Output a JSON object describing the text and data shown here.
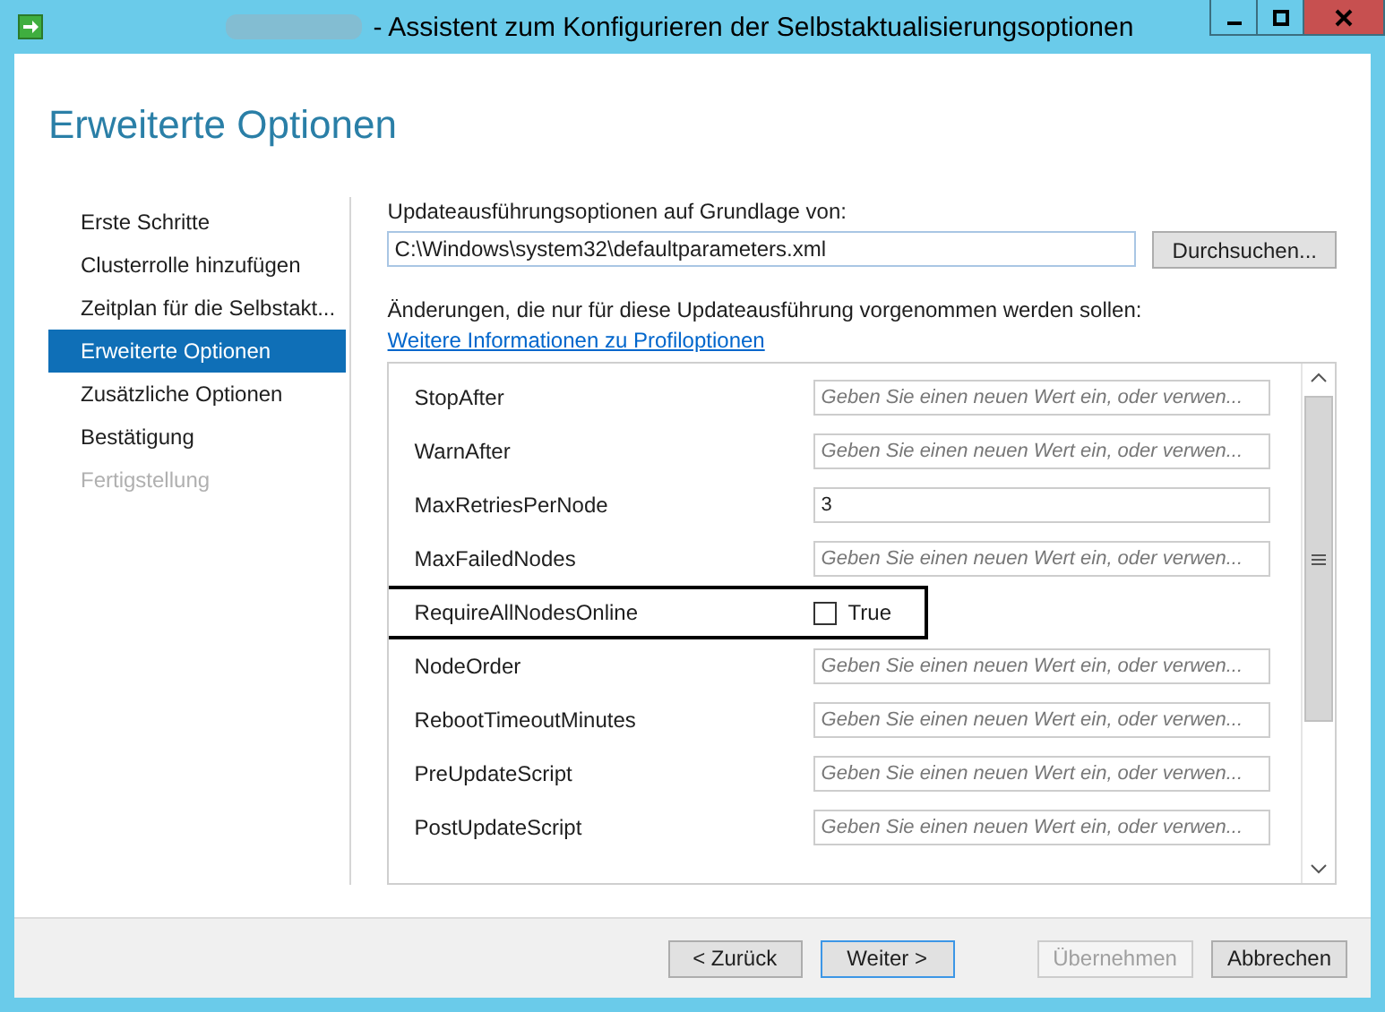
{
  "window": {
    "title": "- Assistent zum Konfigurieren der Selbstaktualisierungsoptionen"
  },
  "page_title": "Erweiterte Optionen",
  "steps": [
    {
      "label": "Erste Schritte",
      "selected": false,
      "disabled": false
    },
    {
      "label": "Clusterrolle hinzufügen",
      "selected": false,
      "disabled": false
    },
    {
      "label": "Zeitplan für die Selbstakt...",
      "selected": false,
      "disabled": false
    },
    {
      "label": "Erweiterte Optionen",
      "selected": true,
      "disabled": false
    },
    {
      "label": "Zusätzliche Optionen",
      "selected": false,
      "disabled": false
    },
    {
      "label": "Bestätigung",
      "selected": false,
      "disabled": false
    },
    {
      "label": "Fertigstellung",
      "selected": false,
      "disabled": true
    }
  ],
  "source": {
    "label": "Updateausführungsoptionen auf Grundlage von:",
    "value": "C:\\Windows\\system32\\defaultparameters.xml",
    "browse_button": "Durchsuchen..."
  },
  "changes_label": "Änderungen, die nur für diese Updateausführung vorgenommen werden sollen:",
  "info_link": "Weitere Informationen zu Profiloptionen",
  "options": [
    {
      "name": "StopAfter",
      "kind": "text",
      "placeholder": "Geben Sie einen neuen Wert ein, oder verwen...",
      "highlighted": false
    },
    {
      "name": "WarnAfter",
      "kind": "text",
      "placeholder": "Geben Sie einen neuen Wert ein, oder verwen...",
      "highlighted": false
    },
    {
      "name": "MaxRetriesPerNode",
      "kind": "text",
      "value": "3",
      "highlighted": false
    },
    {
      "name": "MaxFailedNodes",
      "kind": "text",
      "placeholder": "Geben Sie einen neuen Wert ein, oder verwen...",
      "highlighted": false
    },
    {
      "name": "RequireAllNodesOnline",
      "kind": "checkbox",
      "label": "True",
      "checked": false,
      "highlighted": true
    },
    {
      "name": "NodeOrder",
      "kind": "text",
      "placeholder": "Geben Sie einen neuen Wert ein, oder verwen...",
      "highlighted": false
    },
    {
      "name": "RebootTimeoutMinutes",
      "kind": "text",
      "placeholder": "Geben Sie einen neuen Wert ein, oder verwen...",
      "highlighted": false
    },
    {
      "name": "PreUpdateScript",
      "kind": "text",
      "placeholder": "Geben Sie einen neuen Wert ein, oder verwen...",
      "highlighted": false
    },
    {
      "name": "PostUpdateScript",
      "kind": "text",
      "placeholder": "Geben Sie einen neuen Wert ein, oder verwen...",
      "highlighted": false
    }
  ],
  "buttons": [
    {
      "label": "< Zurück",
      "default": false,
      "disabled": false
    },
    {
      "label": "Weiter >",
      "default": true,
      "disabled": false
    },
    {
      "label": "Übernehmen",
      "default": false,
      "disabled": true
    },
    {
      "label": "Abbrechen",
      "default": false,
      "disabled": false
    }
  ]
}
